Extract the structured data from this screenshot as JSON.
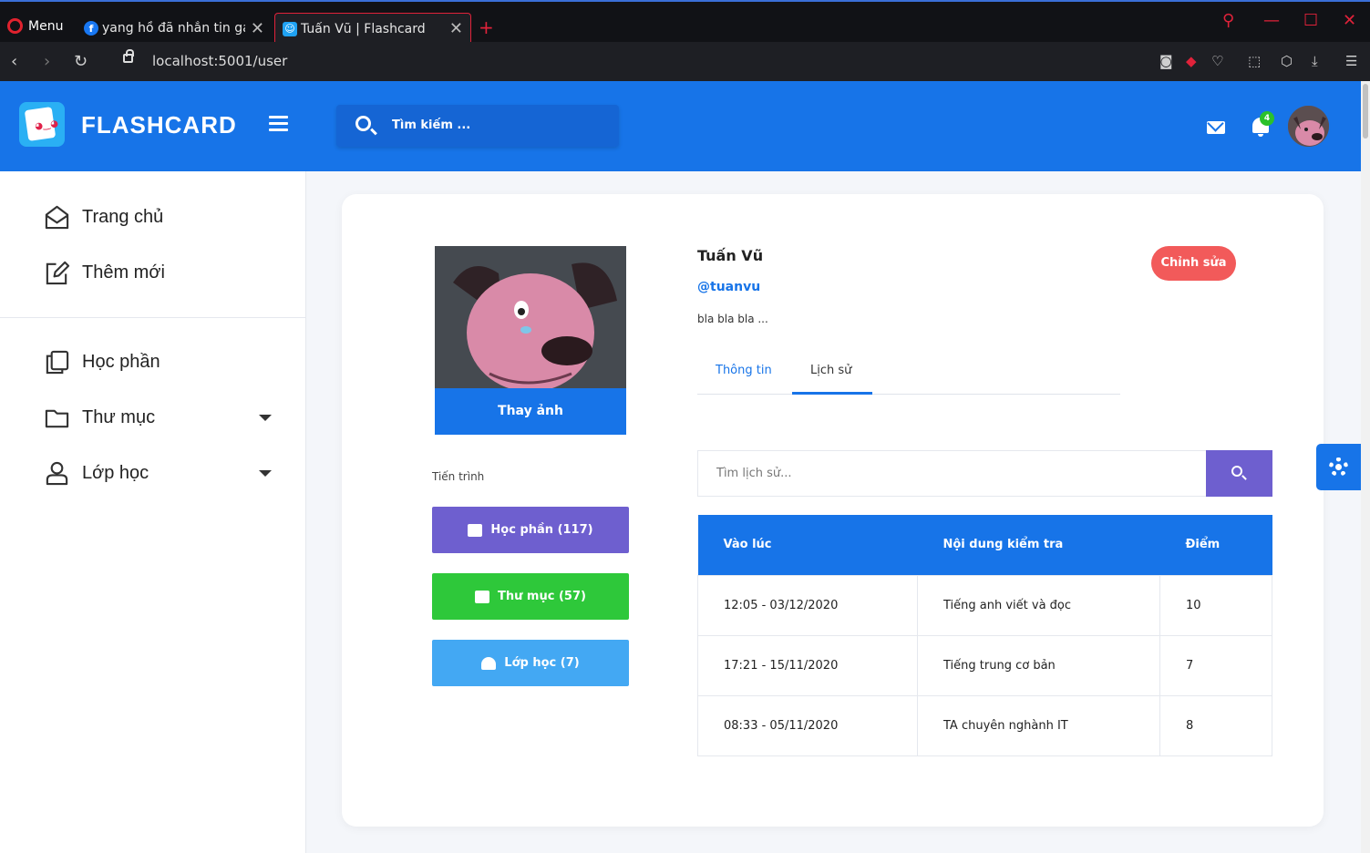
{
  "browser": {
    "menu_label": "Menu",
    "tabs": [
      {
        "label": "yang hồ đã nhắn tin gay"
      },
      {
        "label": "Tuấn Vũ | Flashcard"
      }
    ],
    "url_host": "localhost:5001/user"
  },
  "header": {
    "brand": "FLASHCARD",
    "search_placeholder": "Tìm kiếm ...",
    "notification_count": "4"
  },
  "sidebar": {
    "items": [
      {
        "label": "Trang chủ",
        "icon": "home-icon"
      },
      {
        "label": "Thêm mới",
        "icon": "edit-icon"
      },
      {
        "label": "Học phần",
        "icon": "copy-icon"
      },
      {
        "label": "Thư mục",
        "icon": "folder-icon"
      },
      {
        "label": "Lớp học",
        "icon": "user-icon"
      }
    ]
  },
  "profile": {
    "change_photo": "Thay ảnh",
    "progress_label": "Tiến trình",
    "progress_buttons": [
      {
        "label": "Học phần (117)",
        "color": "#6e5fcf"
      },
      {
        "label": "Thư mục (57)",
        "color": "#2ec83a"
      },
      {
        "label": "Lớp học (7)",
        "color": "#43a8f3"
      }
    ],
    "name": "Tuấn Vũ",
    "handle": "@tuanvu",
    "bio": "bla bla bla ...",
    "edit_button": "Chỉnh sửa",
    "tabs": [
      "Thông tin",
      "Lịch sử"
    ],
    "active_tab": "Lịch sử"
  },
  "history": {
    "search_placeholder": "Tìm lịch sử...",
    "columns": [
      "Vào lúc",
      "Nội dung kiểm tra",
      "Điểm"
    ],
    "rows": [
      [
        "12:05 - 03/12/2020",
        "Tiếng anh viết và đọc",
        "10"
      ],
      [
        "17:21 - 15/11/2020",
        "Tiếng trung cơ bản",
        "7"
      ],
      [
        "08:33 - 05/11/2020",
        "TA chuyên nghành IT",
        "8"
      ]
    ]
  },
  "colors": {
    "primary": "#1774e8",
    "purple": "#6e5fcf",
    "green": "#2ec83a",
    "light_blue": "#43a8f3",
    "danger": "#f25a5a"
  }
}
